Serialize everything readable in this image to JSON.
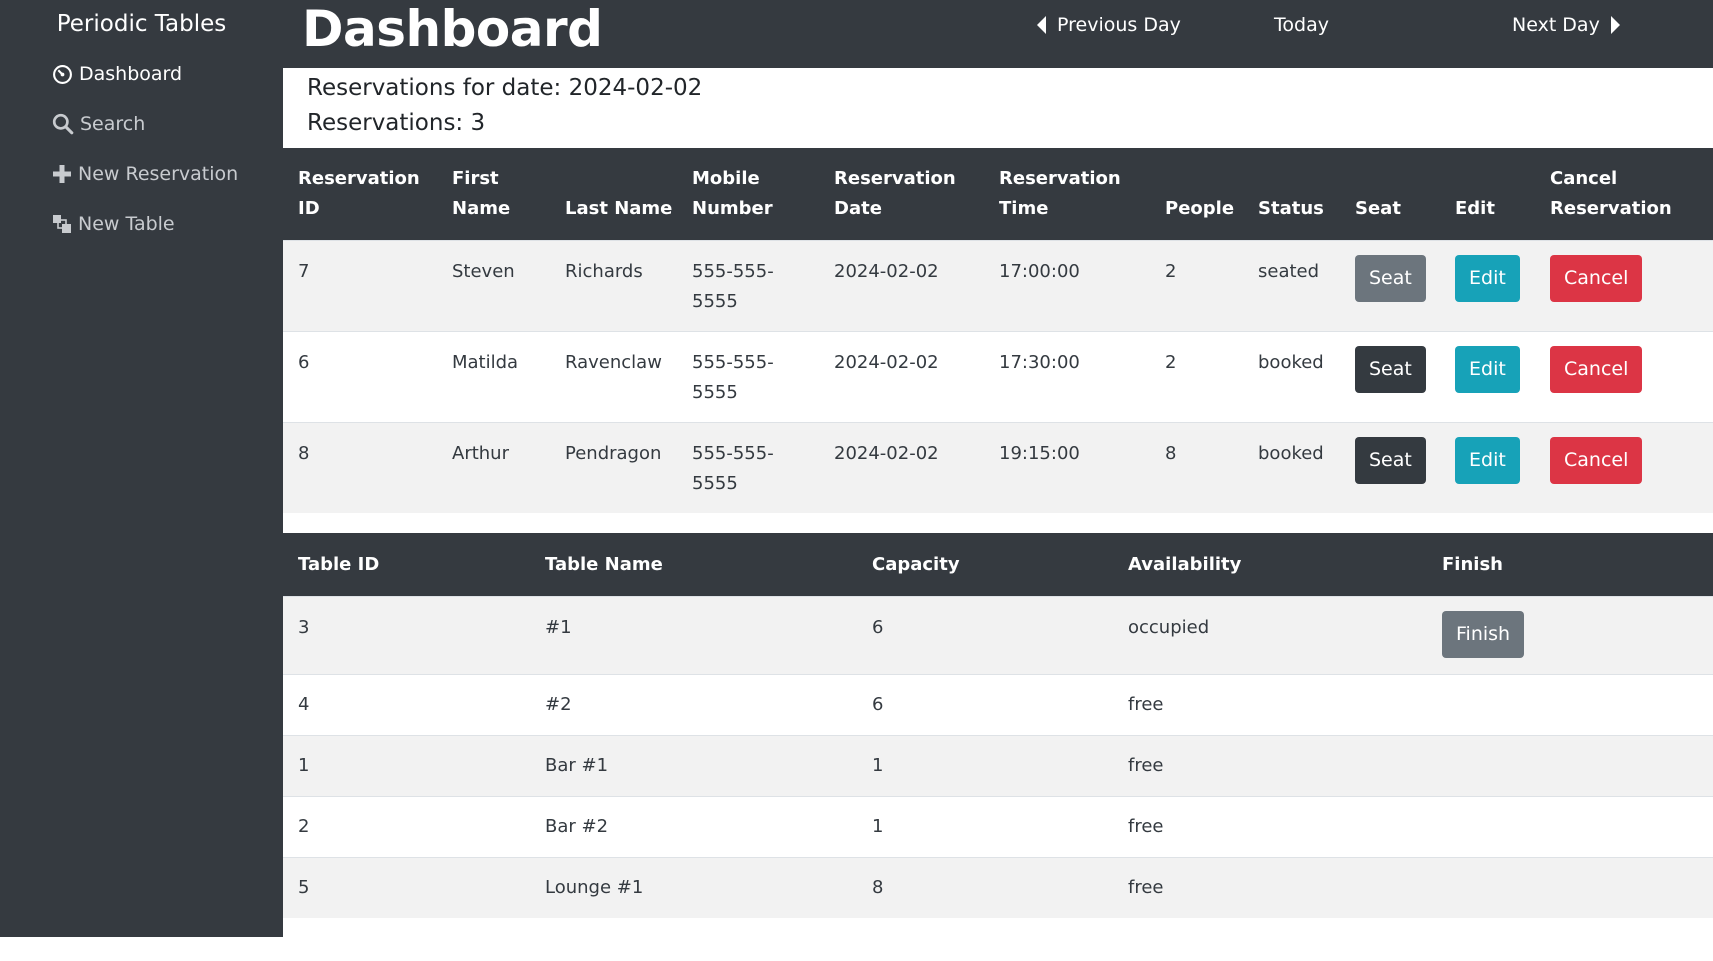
{
  "sidebar": {
    "brand": "Periodic Tables",
    "items": [
      {
        "label": "Dashboard",
        "icon": "dashboard-icon"
      },
      {
        "label": "Search",
        "icon": "search-icon"
      },
      {
        "label": "New Reservation",
        "icon": "plus-icon"
      },
      {
        "label": "New Table",
        "icon": "tables-icon"
      }
    ]
  },
  "header": {
    "title": "Dashboard",
    "previous_label": "Previous Day",
    "today_label": "Today",
    "next_label": "Next Day"
  },
  "summary": {
    "date_line": "Reservations for date: 2024-02-02",
    "count_line": "Reservations: 3"
  },
  "reservations": {
    "columns": [
      "Reservation ID",
      "First Name",
      "Last Name",
      "Mobile Number",
      "Reservation Date",
      "Reservation Time",
      "People",
      "Status",
      "Seat",
      "Edit",
      "Cancel Reservation"
    ],
    "rows": [
      {
        "id": "7",
        "first": "Steven",
        "last": "Richards",
        "mobile": "555-555-5555",
        "date": "2024-02-02",
        "time": "17:00:00",
        "people": "2",
        "status": "seated",
        "seat": "Seat",
        "edit": "Edit",
        "cancel": "Cancel"
      },
      {
        "id": "6",
        "first": "Matilda",
        "last": "Ravenclaw",
        "mobile": "555-555-5555",
        "date": "2024-02-02",
        "time": "17:30:00",
        "people": "2",
        "status": "booked",
        "seat": "Seat",
        "edit": "Edit",
        "cancel": "Cancel"
      },
      {
        "id": "8",
        "first": "Arthur",
        "last": "Pendragon",
        "mobile": "555-555-5555",
        "date": "2024-02-02",
        "time": "19:15:00",
        "people": "8",
        "status": "booked",
        "seat": "Seat",
        "edit": "Edit",
        "cancel": "Cancel"
      }
    ]
  },
  "tables": {
    "columns": [
      "Table ID",
      "Table Name",
      "Capacity",
      "Availability",
      "Finish"
    ],
    "rows": [
      {
        "id": "3",
        "name": "#1",
        "capacity": "6",
        "availability": "occupied",
        "finish": "Finish"
      },
      {
        "id": "4",
        "name": "#2",
        "capacity": "6",
        "availability": "free",
        "finish": ""
      },
      {
        "id": "1",
        "name": "Bar #1",
        "capacity": "1",
        "availability": "free",
        "finish": ""
      },
      {
        "id": "2",
        "name": "Bar #2",
        "capacity": "1",
        "availability": "free",
        "finish": ""
      },
      {
        "id": "5",
        "name": "Lounge #1",
        "capacity": "8",
        "availability": "free",
        "finish": ""
      }
    ]
  },
  "colors": {
    "dark": "#353a40",
    "seat_seated": "#6c757d",
    "seat_booked": "#343a40",
    "edit": "#17a2b8",
    "cancel": "#dc3545",
    "finish": "#6c757d"
  }
}
